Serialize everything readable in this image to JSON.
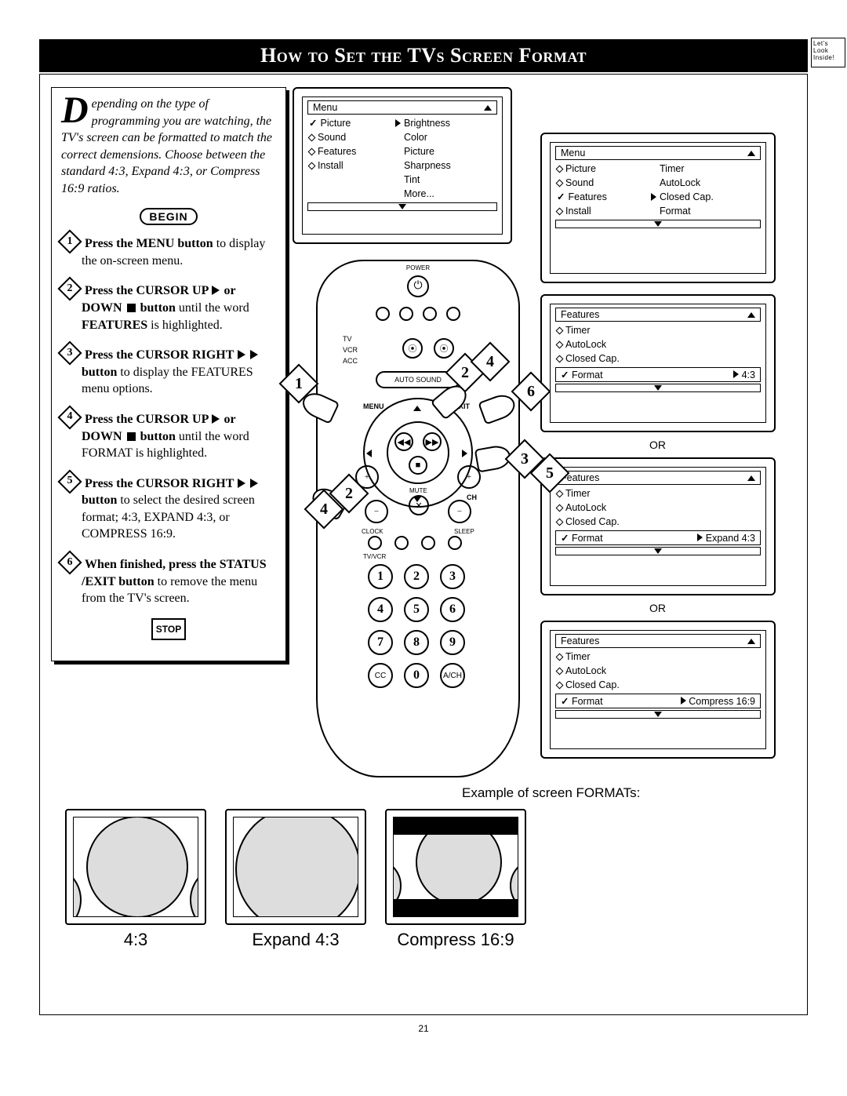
{
  "header": {
    "title": "How to Set the TVs Screen Format",
    "corner_label": "Let's\nLook\nInside!"
  },
  "intro": {
    "dropcap": "D",
    "text": "epending on the type of programming you are watching, the TV's screen can be formatted to match the correct demensions. Choose between the standard 4:3, Expand 4:3, or Compress 16:9 ratios."
  },
  "begin_label": "BEGIN",
  "stop_label": "STOP",
  "steps": [
    {
      "n": "1",
      "bold": "Press the MENU button",
      "rest": " to display the on-screen menu.",
      "icons": []
    },
    {
      "n": "2",
      "bold": "Press the CURSOR UP ▶ or DOWN ■ button",
      "rest": " until the word FEATURES is highlighted.",
      "icons": [
        "r",
        "sq"
      ]
    },
    {
      "n": "3",
      "bold": "Press the CURSOR RIGHT ▶ ▶ button",
      "rest": " to display the FEATURES menu options.",
      "icons": [
        "r",
        "r"
      ]
    },
    {
      "n": "4",
      "bold": "Press the CURSOR UP ▶ or DOWN ■ button",
      "rest": " until the word FORMAT is highlighted.",
      "icons": [
        "r",
        "sq"
      ]
    },
    {
      "n": "5",
      "bold": "Press the CURSOR RIGHT ▶ ▶ button",
      "rest": " to select the desired screen format; 4:3, EXPAND 4:3, or COMPRESS 16:9.",
      "icons": [
        "r",
        "r"
      ]
    },
    {
      "n": "6",
      "bold": "When finished, press the STATUS /EXIT button",
      "rest": " to remove the menu from the TV's screen.",
      "icons": []
    }
  ],
  "menu_main": {
    "title": "Menu",
    "left": [
      {
        "m": "chk",
        "t": "Picture",
        "arrow": true
      },
      {
        "m": "dia",
        "t": "Sound"
      },
      {
        "m": "dia",
        "t": "Features"
      },
      {
        "m": "dia",
        "t": "Install"
      }
    ],
    "right": [
      "Brightness",
      "Color",
      "Picture",
      "Sharpness",
      "Tint",
      "More..."
    ]
  },
  "menu_features_top": {
    "title": "Menu",
    "items": [
      {
        "m": "dia",
        "t": "Picture",
        "r": "Timer"
      },
      {
        "m": "dia",
        "t": "Sound",
        "r": "AutoLock"
      },
      {
        "m": "chk",
        "t": "Features",
        "r": "Closed Cap.",
        "arrow": true
      },
      {
        "m": "dia",
        "t": "Install",
        "r": "Format"
      }
    ]
  },
  "format_menus": [
    {
      "value": "4:3"
    },
    {
      "value": "Expand 4:3"
    },
    {
      "value": "Compress 16:9"
    }
  ],
  "features_title": "Features",
  "features_items": [
    "Timer",
    "AutoLock",
    "Closed Cap."
  ],
  "features_format_label": "Format",
  "or_label": "OR",
  "remote": {
    "power": "POWER",
    "switches": [
      "TV",
      "VCR",
      "ACC"
    ],
    "auto_sound": "AUTO SOUND",
    "menu": "MENU",
    "exit": "EXIT",
    "mute": "MUTE",
    "ch": "CH",
    "clock": "CLOCK",
    "sleep": "SLEEP",
    "tvvcr": "TV/VCR",
    "bottom": [
      "CC",
      "0",
      "A/CH"
    ]
  },
  "callouts": [
    "1",
    "2",
    "4",
    "6",
    "3",
    "5",
    "2",
    "4"
  ],
  "formats_title": "Example of screen FORMATs:",
  "format_labels": [
    "4:3",
    "Expand 4:3",
    "Compress 16:9"
  ],
  "page_number": "21"
}
